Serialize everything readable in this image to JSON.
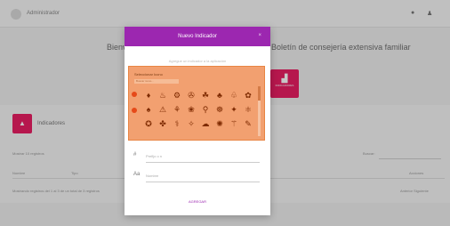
{
  "topbar": {
    "brand": "Administrador",
    "icons": [
      "bell-icon",
      "user-icon"
    ]
  },
  "background": {
    "welcome": "Bienvenido",
    "welcome_right": "Boletín de consejería extensiva familiar",
    "indicator_card": {
      "icon": "chart-icon",
      "label": "INDICADORES"
    },
    "section_title": "Indicadores",
    "rows_label": "Mostrar 10 registros",
    "search_label": "Buscar:",
    "columns": [
      "Nombre",
      "Tipo",
      "",
      "Acciones"
    ],
    "footer_info": "Mostrando registros del 1 al 3 de un total de 3 registros",
    "pager": "Anterior  Siguiente"
  },
  "modal": {
    "title": "Nuevo Indicador",
    "close": "×",
    "subtitle": "Agregue un indicador a la aplicación",
    "icon_picker": {
      "label": "Seleccionar Icono",
      "search_placeholder": "Buscar icono...",
      "icons": [
        "♦",
        "♨",
        "⚙",
        "✇",
        "☘",
        "♣",
        "♧",
        "✿",
        "♠",
        "⚠",
        "⚘",
        "❀",
        "⚲",
        "☸",
        "✦",
        "⚛",
        "✪",
        "✤",
        "⚕",
        "✧",
        "☁",
        "✺",
        "⚚",
        "✎"
      ]
    },
    "fields": [
      {
        "icon": "#",
        "placeholder": "Prefijo o n"
      },
      {
        "icon": "Aa",
        "placeholder": "Nombre"
      }
    ],
    "submit": "AGREGAR"
  }
}
